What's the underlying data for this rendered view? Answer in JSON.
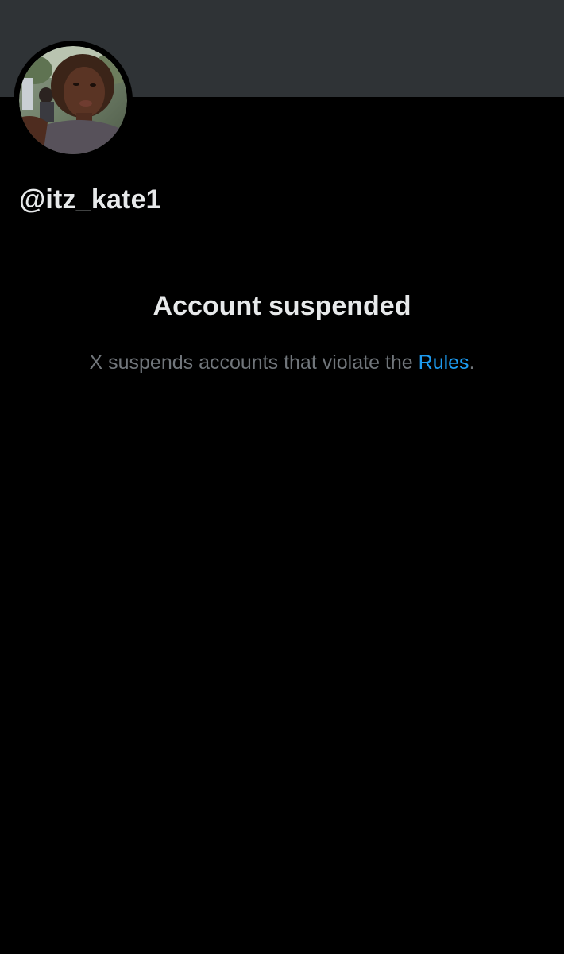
{
  "profile": {
    "handle": "@itz_kate1",
    "avatar_icon": "profile-photo",
    "banner_color": "#2f3336"
  },
  "notice": {
    "title": "Account suspended",
    "description_prefix": "X suspends accounts that violate the ",
    "rules_link": "Rules",
    "description_suffix": "."
  },
  "colors": {
    "background": "#000000",
    "text_primary": "#e7e9ea",
    "text_secondary": "#71767b",
    "link": "#1d9bf0"
  }
}
